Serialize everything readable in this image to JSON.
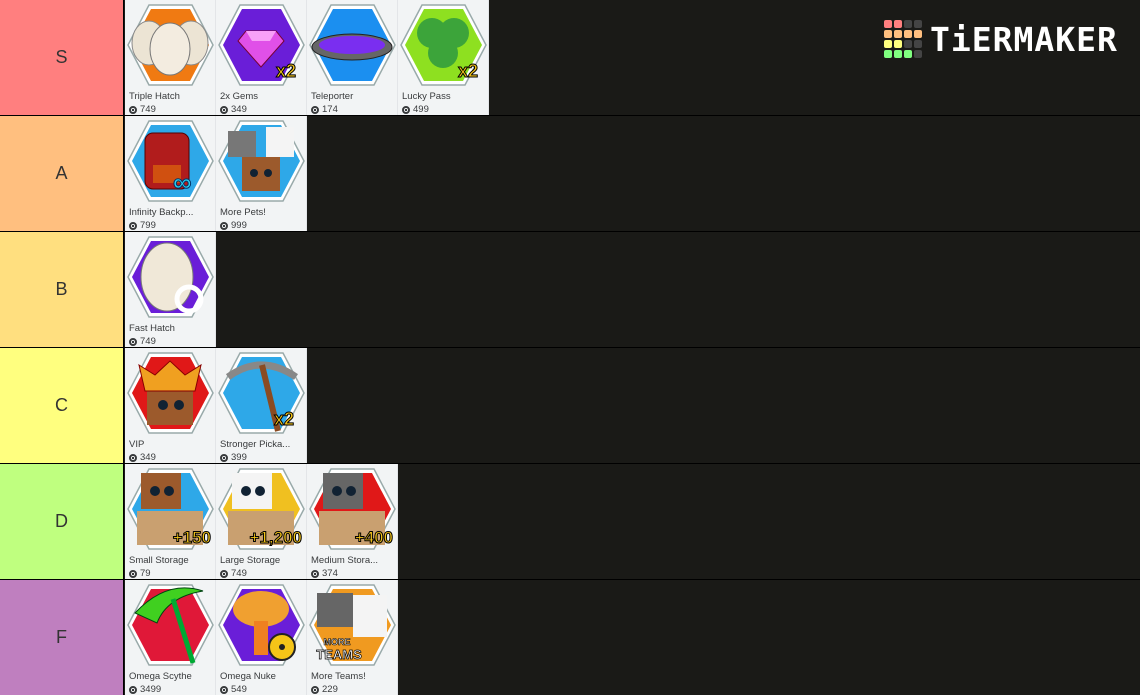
{
  "logo": {
    "text": "TiERMAKER",
    "grid": [
      [
        "#ff7f7f",
        "#ff7f7f",
        "#444444",
        "#444444"
      ],
      [
        "#ffbf7f",
        "#ffbf7f",
        "#ffbf7f",
        "#ffbf7f"
      ],
      [
        "#ffff7f",
        "#ffff7f",
        "#444444",
        "#444444"
      ],
      [
        "#7fff7f",
        "#7fff7f",
        "#7fff7f",
        "#444444"
      ]
    ]
  },
  "tiers": [
    {
      "label": "S",
      "color": "#ff7f7f",
      "items": [
        {
          "name": "Triple Hatch",
          "price": "749",
          "icon": "triple-eggs-icon",
          "bg": "#f07a12",
          "art": "eggs"
        },
        {
          "name": "2x Gems",
          "price": "349",
          "icon": "gem-x2-icon",
          "bg": "#6a1ed8",
          "art": "gem"
        },
        {
          "name": "Teleporter",
          "price": "174",
          "icon": "teleporter-pad-icon",
          "bg": "#1b8ff0",
          "art": "pad"
        },
        {
          "name": "Lucky Pass",
          "price": "499",
          "icon": "clover-x2-icon",
          "bg": "#8ee020",
          "art": "clover"
        }
      ]
    },
    {
      "label": "A",
      "color": "#ffbf7f",
      "items": [
        {
          "name": "Infinity Backp...",
          "price": "799",
          "icon": "infinity-backpack-icon",
          "bg": "#2ea8e8",
          "art": "backpack"
        },
        {
          "name": "More Pets!",
          "price": "999",
          "icon": "pets-group-icon",
          "bg": "#2ea8e8",
          "art": "pets"
        }
      ]
    },
    {
      "label": "B",
      "color": "#ffdf7f",
      "items": [
        {
          "name": "Fast Hatch",
          "price": "749",
          "icon": "fast-egg-icon",
          "bg": "#6a1ed8",
          "art": "egg"
        }
      ]
    },
    {
      "label": "C",
      "color": "#ffff7f",
      "items": [
        {
          "name": "VIP",
          "price": "349",
          "icon": "crowned-dog-icon",
          "bg": "#e01818",
          "art": "vip"
        },
        {
          "name": "Stronger Picka...",
          "price": "399",
          "icon": "pickaxe-x2-icon",
          "bg": "#2ea8e8",
          "art": "pickaxe"
        }
      ]
    },
    {
      "label": "D",
      "color": "#bfff7f",
      "items": [
        {
          "name": "Small Storage",
          "price": "79",
          "icon": "storage-boxes-icon",
          "bg": "#2ea8e8",
          "art": "storage",
          "badge": "+150"
        },
        {
          "name": "Large Storage",
          "price": "749",
          "icon": "storage-boxes-icon",
          "bg": "#f0c020",
          "art": "storage",
          "badge": "+1,200"
        },
        {
          "name": "Medium Stora...",
          "price": "374",
          "icon": "storage-boxes-icon",
          "bg": "#e01818",
          "art": "storage",
          "badge": "+400"
        }
      ]
    },
    {
      "label": "F",
      "color": "#bf7fbf",
      "items": [
        {
          "name": "Omega Scythe",
          "price": "3499",
          "icon": "scythe-icon",
          "bg": "#e01838",
          "art": "scythe"
        },
        {
          "name": "Omega Nuke",
          "price": "549",
          "icon": "nuke-icon",
          "bg": "#6a1ed8",
          "art": "nuke"
        },
        {
          "name": "More Teams!",
          "price": "229",
          "icon": "teams-icon",
          "bg": "#f09a20",
          "art": "teams",
          "badge": "MORE TEAMS"
        }
      ]
    }
  ]
}
